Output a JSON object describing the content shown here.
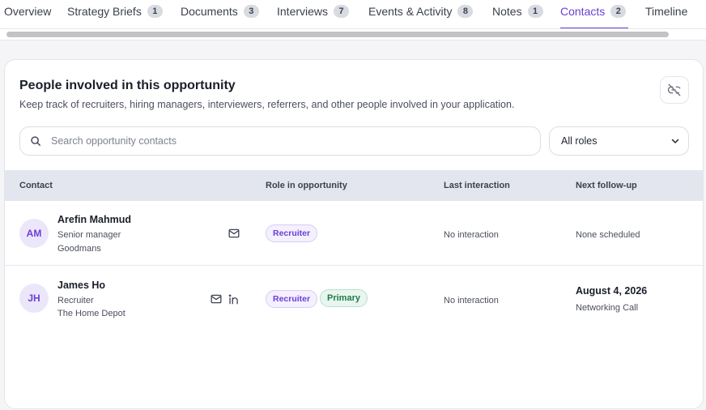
{
  "tabs": [
    {
      "label": "Overview",
      "count": null
    },
    {
      "label": "Strategy Briefs",
      "count": "1"
    },
    {
      "label": "Documents",
      "count": "3"
    },
    {
      "label": "Interviews",
      "count": "7"
    },
    {
      "label": "Events & Activity",
      "count": "8"
    },
    {
      "label": "Notes",
      "count": "1"
    },
    {
      "label": "Contacts",
      "count": "2",
      "active": true
    },
    {
      "label": "Timeline",
      "count": null
    }
  ],
  "card": {
    "title": "People involved in this opportunity",
    "subtitle": "Keep track of recruiters, hiring managers, interviewers, referrers, and other people involved in your application."
  },
  "search": {
    "placeholder": "Search opportunity contacts"
  },
  "role_filter": {
    "selected": "All roles"
  },
  "table": {
    "headers": [
      "Contact",
      "Role in opportunity",
      "Last interaction",
      "Next follow-up"
    ],
    "rows": [
      {
        "initials": "AM",
        "name": "Arefin Mahmud",
        "title": "Senior manager",
        "company": "Goodmans",
        "roles": [
          "Recruiter"
        ],
        "last_interaction": "No interaction",
        "next_followup": "None scheduled",
        "followup_detail": ""
      },
      {
        "initials": "JH",
        "name": "James Ho",
        "title": "Recruiter",
        "company": "The Home Depot",
        "roles": [
          "Recruiter",
          "Primary"
        ],
        "last_interaction": "No interaction",
        "next_followup": "August 4, 2026",
        "followup_detail": "Networking Call"
      }
    ]
  },
  "colors": {
    "accent": "#6b3fd4",
    "primary_badge": "#1f7a4a"
  }
}
